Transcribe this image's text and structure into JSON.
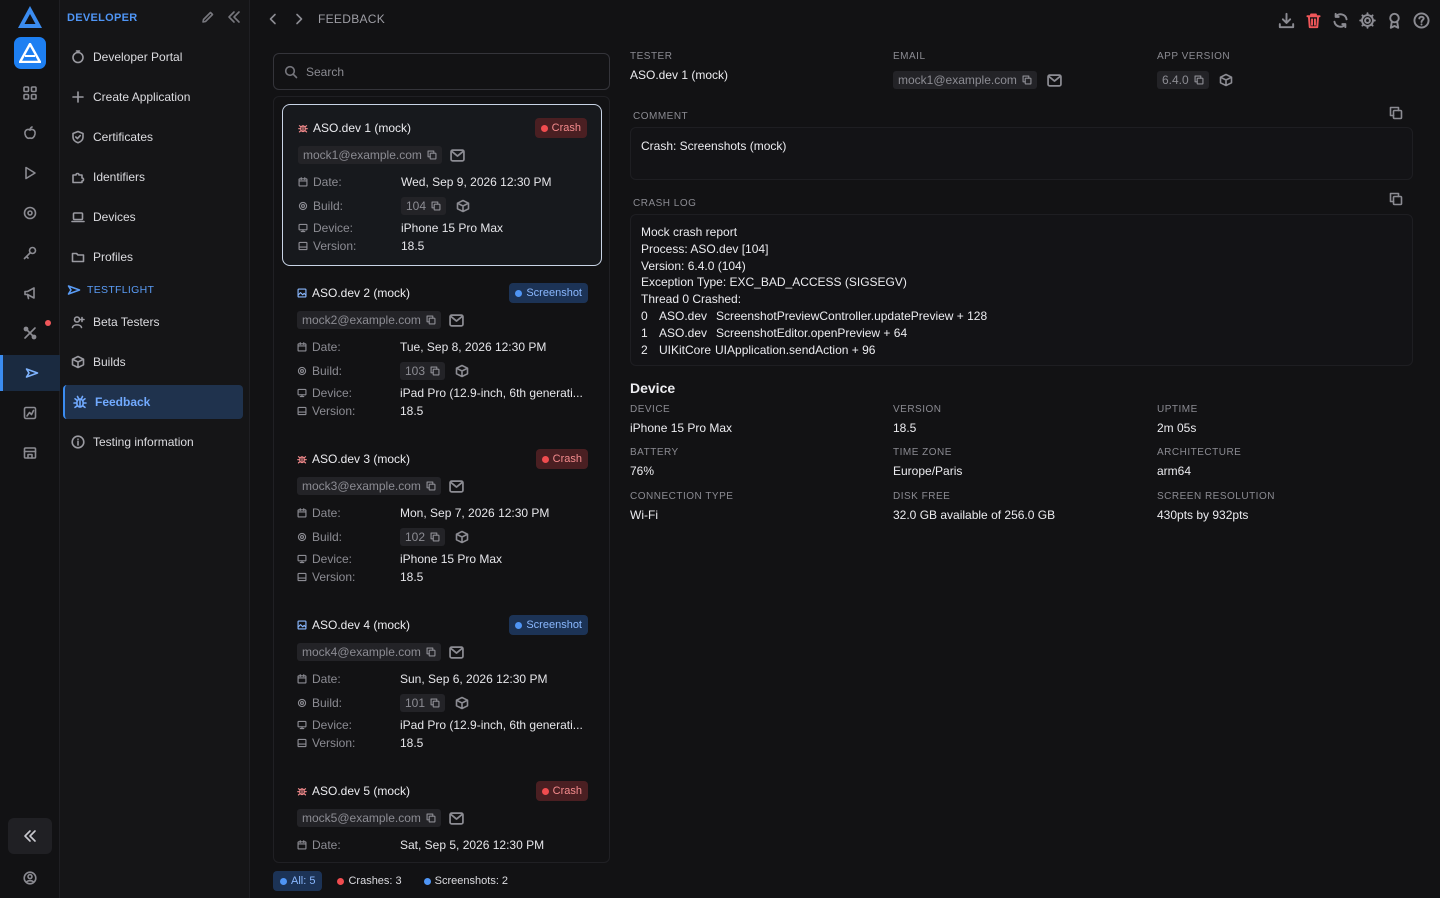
{
  "rail": {
    "items": [
      "apps",
      "apple",
      "play",
      "eye",
      "key",
      "megaphone",
      "tools",
      "testflight",
      "analytics",
      "store"
    ]
  },
  "sidebar": {
    "heading": "DEVELOPER",
    "items": [
      {
        "label": "Developer Portal"
      },
      {
        "label": "Create Application"
      },
      {
        "label": "Certificates"
      },
      {
        "label": "Identifiers"
      },
      {
        "label": "Devices"
      },
      {
        "label": "Profiles"
      }
    ],
    "section": "TESTFLIGHT",
    "testflight_items": [
      {
        "label": "Beta Testers"
      },
      {
        "label": "Builds"
      },
      {
        "label": "Feedback"
      },
      {
        "label": "Testing information"
      }
    ]
  },
  "header": {
    "breadcrumb": "FEEDBACK"
  },
  "search": {
    "placeholder": "Search"
  },
  "labels": {
    "date": "Date:",
    "build": "Build:",
    "device": "Device:",
    "version": "Version:"
  },
  "feedback": [
    {
      "title": "ASO.dev 1 (mock)",
      "type": "Crash",
      "email": "mock1@example.com",
      "date": "Wed, Sep 9, 2026 12:30 PM",
      "build": "104",
      "device": "iPhone 15 Pro Max",
      "version": "18.5"
    },
    {
      "title": "ASO.dev 2 (mock)",
      "type": "Screenshot",
      "email": "mock2@example.com",
      "date": "Tue, Sep 8, 2026 12:30 PM",
      "build": "103",
      "device": "iPad Pro (12.9-inch, 6th generati...",
      "version": "18.5"
    },
    {
      "title": "ASO.dev 3 (mock)",
      "type": "Crash",
      "email": "mock3@example.com",
      "date": "Mon, Sep 7, 2026 12:30 PM",
      "build": "102",
      "device": "iPhone 15 Pro Max",
      "version": "18.5"
    },
    {
      "title": "ASO.dev 4 (mock)",
      "type": "Screenshot",
      "email": "mock4@example.com",
      "date": "Sun, Sep 6, 2026 12:30 PM",
      "build": "101",
      "device": "iPad Pro (12.9-inch, 6th generati...",
      "version": "18.5"
    },
    {
      "title": "ASO.dev 5 (mock)",
      "type": "Crash",
      "email": "mock5@example.com",
      "date": "Sat, Sep 5, 2026 12:30 PM"
    }
  ],
  "filters": {
    "all": "All: 5",
    "crashes": "Crashes: 3",
    "screenshots": "Screenshots: 2"
  },
  "detail": {
    "tester_label": "TESTER",
    "tester": "ASO.dev 1 (mock)",
    "email_label": "EMAIL",
    "email": "mock1@example.com",
    "app_version_label": "APP VERSION",
    "app_version": "6.4.0",
    "comment_label": "COMMENT",
    "comment": "Crash: Screenshots (mock)",
    "crash_log_label": "CRASH LOG",
    "crash_log": [
      "Mock crash report",
      "Process: ASO.dev [104]",
      "Version: 6.4.0 (104)",
      "Exception Type: EXC_BAD_ACCESS (SIGSEGV)",
      "Thread 0 Crashed:"
    ],
    "frames": [
      {
        "n": "0",
        "module": "ASO.dev",
        "symbol": "ScreenshotPreviewController.updatePreview + 128"
      },
      {
        "n": "1",
        "module": "ASO.dev",
        "symbol": "ScreenshotEditor.openPreview + 64"
      },
      {
        "n": "2",
        "module": "UIKitCore",
        "symbol": "UIApplication.sendAction + 96"
      }
    ],
    "device_section": "Device",
    "device_fields": [
      {
        "label": "DEVICE",
        "value": "iPhone 15 Pro Max"
      },
      {
        "label": "VERSION",
        "value": "18.5"
      },
      {
        "label": "UPTIME",
        "value": "2m 05s"
      },
      {
        "label": "BATTERY",
        "value": "76%"
      },
      {
        "label": "TIME ZONE",
        "value": "Europe/Paris"
      },
      {
        "label": "ARCHITECTURE",
        "value": "arm64"
      },
      {
        "label": "CONNECTION TYPE",
        "value": "Wi-Fi"
      },
      {
        "label": "DISK FREE",
        "value": "32.0 GB available of 256.0 GB"
      },
      {
        "label": "SCREEN RESOLUTION",
        "value": "430pts by 932pts"
      }
    ]
  },
  "colors": {
    "accent": "#3b8cf0",
    "crash": "#f04c4f",
    "screenshot": "#4f95f5",
    "background": "#121214"
  }
}
